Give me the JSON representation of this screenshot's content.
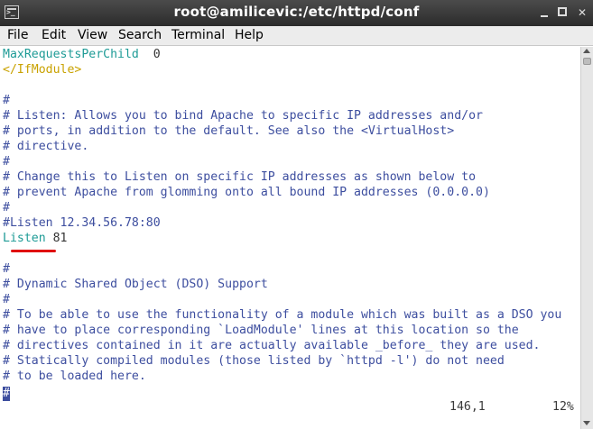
{
  "window": {
    "title": "root@amilicevic:/etc/httpd/conf"
  },
  "menubar": {
    "items": [
      "File",
      "Edit",
      "View",
      "Search",
      "Terminal",
      "Help"
    ]
  },
  "editor": {
    "lines": [
      {
        "parts": [
          {
            "text": "MaxRequestsPerChild",
            "kind": "directive"
          },
          {
            "text": "  0",
            "kind": "value"
          }
        ]
      },
      {
        "parts": [
          {
            "text": "</IfModule>",
            "kind": "tag"
          }
        ]
      },
      {
        "parts": [
          {
            "text": "",
            "kind": "value"
          }
        ]
      },
      {
        "parts": [
          {
            "text": "#",
            "kind": "comment"
          }
        ]
      },
      {
        "parts": [
          {
            "text": "# Listen: Allows you to bind Apache to specific IP addresses and/or",
            "kind": "comment"
          }
        ]
      },
      {
        "parts": [
          {
            "text": "# ports, in addition to the default. See also the <VirtualHost>",
            "kind": "comment"
          }
        ]
      },
      {
        "parts": [
          {
            "text": "# directive.",
            "kind": "comment"
          }
        ]
      },
      {
        "parts": [
          {
            "text": "#",
            "kind": "comment"
          }
        ]
      },
      {
        "parts": [
          {
            "text": "# Change this to Listen on specific IP addresses as shown below to",
            "kind": "comment"
          }
        ]
      },
      {
        "parts": [
          {
            "text": "# prevent Apache from glomming onto all bound IP addresses (0.0.0.0)",
            "kind": "comment"
          }
        ]
      },
      {
        "parts": [
          {
            "text": "#",
            "kind": "comment"
          }
        ]
      },
      {
        "parts": [
          {
            "text": "#Listen 12.34.56.78:80",
            "kind": "comment"
          }
        ]
      },
      {
        "parts": [
          {
            "text": "Listen",
            "kind": "directive"
          },
          {
            "text": " 81",
            "kind": "value"
          }
        ]
      },
      {
        "parts": [
          {
            "text": "",
            "kind": "value"
          }
        ]
      },
      {
        "parts": [
          {
            "text": "#",
            "kind": "comment"
          }
        ]
      },
      {
        "parts": [
          {
            "text": "# Dynamic Shared Object (DSO) Support",
            "kind": "comment"
          }
        ]
      },
      {
        "parts": [
          {
            "text": "#",
            "kind": "comment"
          }
        ]
      },
      {
        "parts": [
          {
            "text": "# To be able to use the functionality of a module which was built as a DSO you",
            "kind": "comment"
          }
        ]
      },
      {
        "parts": [
          {
            "text": "# have to place corresponding `LoadModule' lines at this location so the",
            "kind": "comment"
          }
        ]
      },
      {
        "parts": [
          {
            "text": "# directives contained in it are actually available _before_ they are used.",
            "kind": "comment"
          }
        ]
      },
      {
        "parts": [
          {
            "text": "# Statically compiled modules (those listed by `httpd -l') do not need",
            "kind": "comment"
          }
        ]
      },
      {
        "parts": [
          {
            "text": "# to be loaded here.",
            "kind": "comment"
          }
        ]
      },
      {
        "parts": [
          {
            "text": "#",
            "kind": "comment"
          }
        ]
      }
    ],
    "cursor_char": "#",
    "status_position": "146,1",
    "status_percent": "12%"
  },
  "colors": {
    "comment": "#3d4e9f",
    "directive": "#1e9b96",
    "tag": "#c9a200",
    "annotation_underline": "#e01010"
  }
}
